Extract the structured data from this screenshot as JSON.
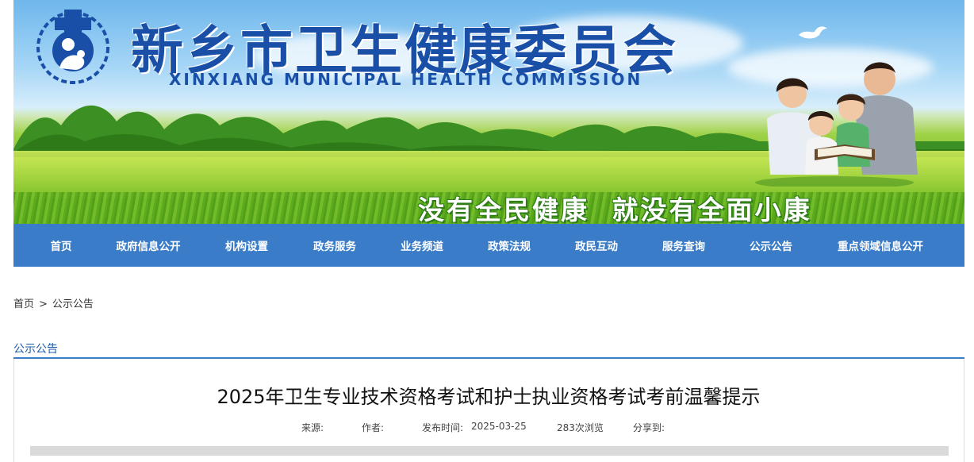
{
  "header": {
    "title_cn": "新乡市卫生健康委员会",
    "title_en": "XINXIANG MUNICIPAL HEALTH COMMISSION",
    "slogan": "没有全民健康  就没有全面小康",
    "accent_color": "#1a4fa8"
  },
  "nav": {
    "background": "#3a7cc7",
    "items": [
      {
        "label": "首页"
      },
      {
        "label": "政府信息公开"
      },
      {
        "label": "机构设置"
      },
      {
        "label": "政务服务"
      },
      {
        "label": "业务频道"
      },
      {
        "label": "政策法规"
      },
      {
        "label": "政民互动"
      },
      {
        "label": "服务查询"
      },
      {
        "label": "公示公告"
      },
      {
        "label": "重点领域信息公开"
      }
    ]
  },
  "breadcrumb": {
    "home": "首页",
    "separator": ">",
    "current": "公示公告"
  },
  "section": {
    "title": "公示公告"
  },
  "article": {
    "title": "2025年卫生专业技术资格考试和护士执业资格考试考前温馨提示",
    "meta": {
      "source_label": "来源:",
      "author_label": "作者:",
      "date_label": "发布时间:",
      "date": "2025-03-25",
      "views": "283次浏览",
      "share_label": "分享到:"
    }
  },
  "icons": {
    "logo": "health-commission-logo-icon",
    "dove": "dove-icon",
    "family": "family-reading-illustration"
  }
}
